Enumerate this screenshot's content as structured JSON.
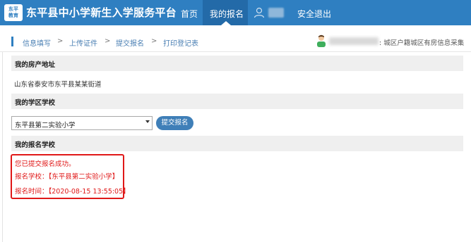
{
  "header": {
    "logo_text": "东平\n教育",
    "title": "东平县中小学新生入学服务平台",
    "nav": {
      "home": "首页",
      "my_registration": "我的报名",
      "logout": "安全退出"
    }
  },
  "breadcrumb": {
    "steps": [
      "信息填写",
      "上传证件",
      "提交报名",
      "打印登记表"
    ],
    "separator": ">"
  },
  "user_info": {
    "category_text": ": 城区户籍城区有房信息采集"
  },
  "sections": {
    "property": {
      "title": "我的房产地址",
      "address": "山东省泰安市东平县某某街道"
    },
    "district_school": {
      "title": "我的学区学校",
      "selected_school": "东平县第二实验小学",
      "submit_label": "提交报名"
    },
    "registered_school": {
      "title": "我的报名学校",
      "success_message": "您已提交报名成功。",
      "school_line": "报名学校：【东平县第二实验小学】",
      "time_line": "报名时间：【2020-08-15 13:55:05】"
    }
  },
  "colors": {
    "header_bg": "#2f7fc1",
    "nav_active_bg": "#236aa8",
    "accent_red": "#e01818",
    "button_bg": "#3f7fb8"
  },
  "icons": [
    "user-icon",
    "avatar-icon",
    "select-arrow-icon"
  ]
}
